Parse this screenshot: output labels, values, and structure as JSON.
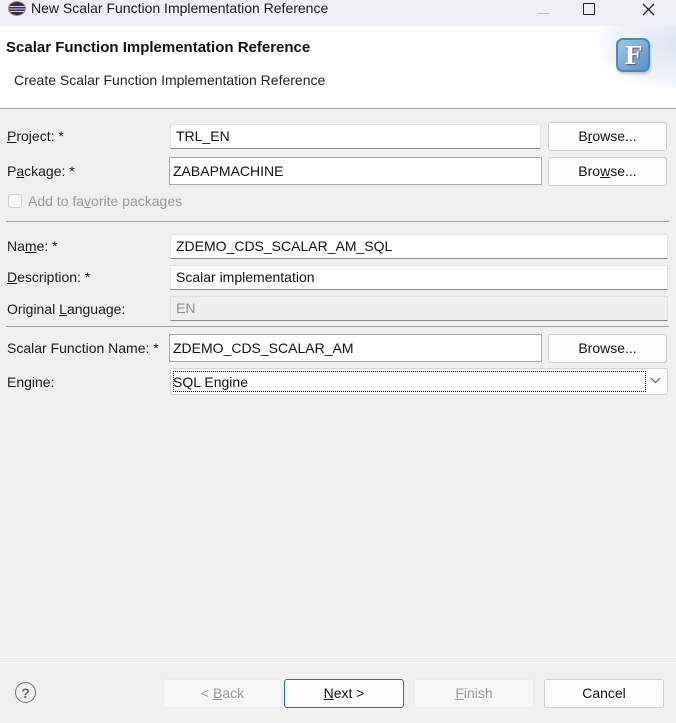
{
  "window": {
    "title": "New Scalar Function Implementation Reference",
    "controls": {
      "minimize": "minimize",
      "maximize": "maximize",
      "close": "close"
    }
  },
  "banner": {
    "heading": "Scalar Function Implementation Reference",
    "subheading": "Create Scalar Function Implementation Reference",
    "icon_letter": "F"
  },
  "form": {
    "project": {
      "label_pre": "",
      "label_mnemonic": "P",
      "label_post": "roject: *",
      "value": "TRL_EN",
      "browse_pre": "B",
      "browse_mnemonic": "r",
      "browse_post": "owse..."
    },
    "package": {
      "label_pre": "P",
      "label_mnemonic": "a",
      "label_post": "ckage: *",
      "value": "ZABAPMACHINE",
      "browse_pre": "Bro",
      "browse_mnemonic": "w",
      "browse_post": "se..."
    },
    "favorite": {
      "label_pre": "Add to fa",
      "label_mnemonic": "v",
      "label_post": "orite packages",
      "checked": false,
      "enabled": false
    },
    "name": {
      "label_pre": "Na",
      "label_mnemonic": "m",
      "label_post": "e: *",
      "value": "ZDEMO_CDS_SCALAR_AM_SQL"
    },
    "description": {
      "label_pre": "",
      "label_mnemonic": "D",
      "label_post": "escription: *",
      "value": "Scalar implementation"
    },
    "original_language": {
      "label_pre": "Original ",
      "label_mnemonic": "L",
      "label_post": "anguage:",
      "value": "EN"
    },
    "scalar_function_name": {
      "label": "Scalar Function Name: *",
      "value": "ZDEMO_CDS_SCALAR_AM",
      "browse_label": "Browse..."
    },
    "engine": {
      "label": "Engine:",
      "value": "SQL Engine"
    }
  },
  "footer": {
    "help_glyph": "?",
    "back": {
      "pre": "< ",
      "mnemonic": "B",
      "post": "ack",
      "enabled": false
    },
    "next": {
      "pre": "",
      "mnemonic": "N",
      "post": "ext >",
      "enabled": true
    },
    "finish": {
      "pre": "",
      "mnemonic": "F",
      "post": "inish",
      "enabled": false
    },
    "cancel": {
      "label": "Cancel",
      "enabled": true
    }
  }
}
